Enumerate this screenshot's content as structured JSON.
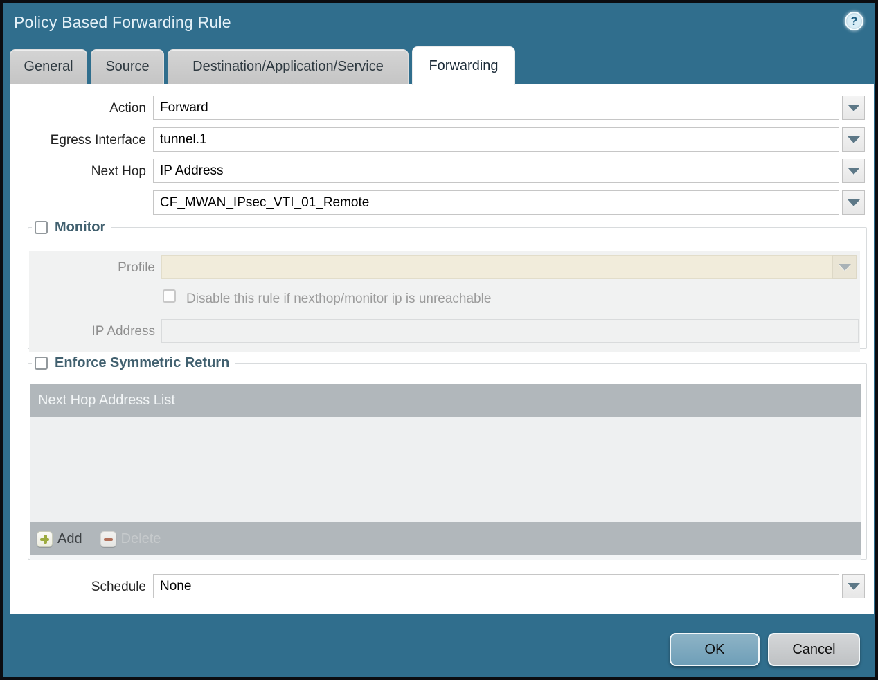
{
  "window": {
    "title": "Policy Based Forwarding Rule"
  },
  "icons": {
    "help_glyph": "?"
  },
  "tabs": [
    {
      "label": "General",
      "active": false
    },
    {
      "label": "Source",
      "active": false
    },
    {
      "label": "Destination/Application/Service",
      "active": false
    },
    {
      "label": "Forwarding",
      "active": true
    }
  ],
  "form": {
    "action": {
      "label": "Action",
      "value": "Forward"
    },
    "egress_interface": {
      "label": "Egress Interface",
      "value": "tunnel.1"
    },
    "next_hop": {
      "label": "Next Hop",
      "value": "IP Address"
    },
    "next_hop_address": {
      "value": "CF_MWAN_IPsec_VTI_01_Remote"
    },
    "schedule": {
      "label": "Schedule",
      "value": "None"
    }
  },
  "monitor": {
    "legend": "Monitor",
    "checked": false,
    "profile": {
      "label": "Profile",
      "value": ""
    },
    "disable_rule": {
      "label": "Disable this rule if nexthop/monitor ip is unreachable",
      "checked": false
    },
    "ip_address": {
      "label": "IP Address",
      "value": ""
    }
  },
  "symmetric_return": {
    "legend": "Enforce Symmetric Return",
    "checked": false,
    "table_header": "Next Hop Address List",
    "rows": [],
    "add_label": "Add",
    "delete_label": "Delete"
  },
  "footer": {
    "ok_label": "OK",
    "cancel_label": "Cancel"
  },
  "colors": {
    "window_background": "#306e8d",
    "title_text": "#e4f1f8",
    "active_tab_background": "#ffffff",
    "inactive_tab_background": "#c9c9c9",
    "fieldset_legend_text": "#41606f",
    "disabled_field_beige": "#f1ecdb",
    "panel_gray": "#f1f2f2",
    "table_header_gray": "#b1b7bb",
    "table_body_gray": "#eef0f1",
    "add_icon_green": "#9cab3f",
    "delete_icon_red": "#b2705a",
    "ok_button": "#7ba6bd",
    "cancel_button": "#c7cacc"
  }
}
